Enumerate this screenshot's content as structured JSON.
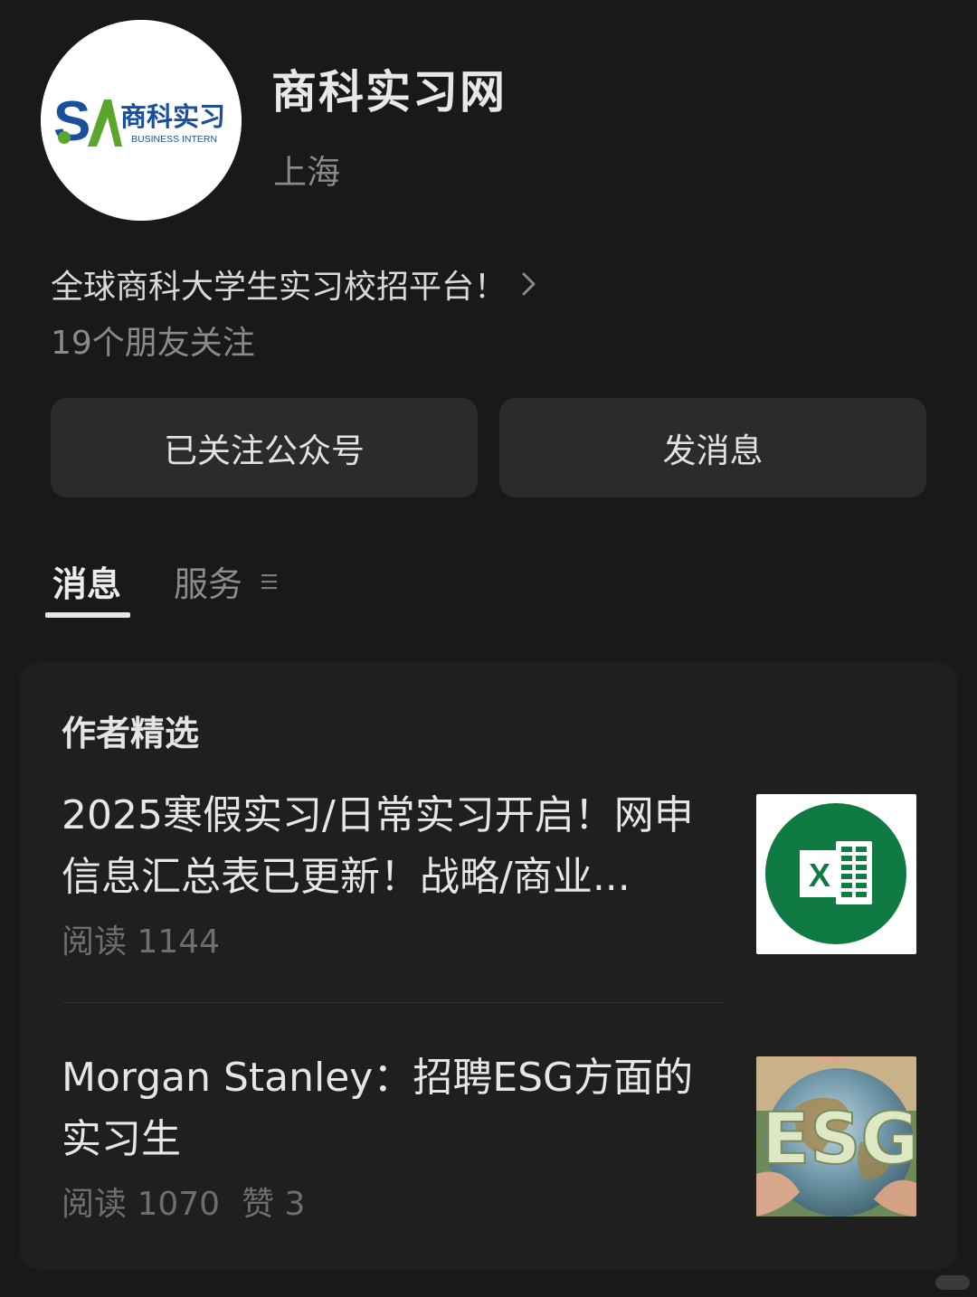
{
  "account": {
    "name": "商科实习网",
    "location": "上海",
    "intro": "全球商科大学生实习校招平台！",
    "followers": "19个朋友关注",
    "logo": {
      "initials": "SA",
      "cn_text": "商科实习",
      "en_text": "BUSINESS INTERN",
      "colors": {
        "blue": "#1a4fa0",
        "green": "#5aa52c"
      }
    }
  },
  "buttons": {
    "followed_label": "已关注公众号",
    "message_label": "发消息"
  },
  "tabs": [
    {
      "label": "消息",
      "active": true
    },
    {
      "label": "服务",
      "active": false
    }
  ],
  "section": {
    "title": "作者精选"
  },
  "articles": [
    {
      "title": "2025寒假实习/日常实习开启！网申信息汇总表已更新！战略/商业...",
      "reads": "阅读 1144",
      "likes": "",
      "thumb_icon": "excel-icon"
    },
    {
      "title": "Morgan Stanley：招聘ESG方面的实习生",
      "reads": "阅读 1070",
      "likes": "赞 3",
      "thumb_icon": "esg-globe-image",
      "thumb_text": "ESG"
    }
  ],
  "colors": {
    "background": "#191919",
    "card": "#1f1f1f",
    "button": "#2b2b2b",
    "excel_green": "#0f7b42"
  }
}
